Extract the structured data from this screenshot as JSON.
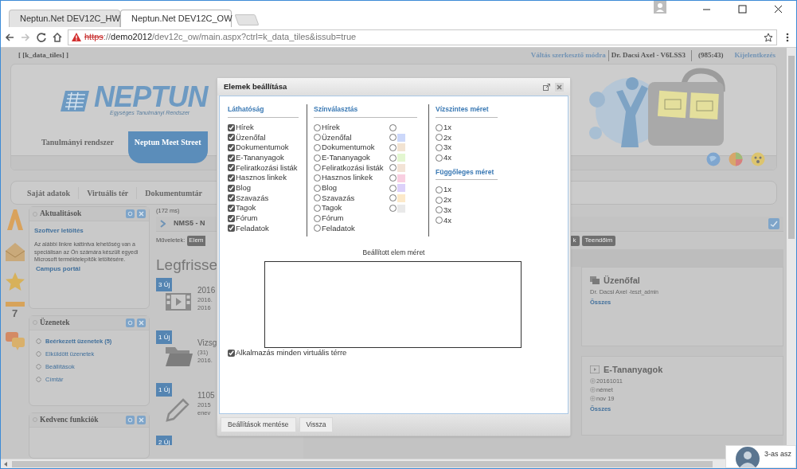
{
  "browser": {
    "tabs": [
      {
        "title": "Neptun.Net DEV12C_HW",
        "selected": false
      },
      {
        "title": "Neptun.Net DEV12C_OW",
        "selected": true
      }
    ],
    "url": {
      "scheme": "https",
      "separator": "://",
      "host": "demo2012",
      "path": "/dev12c_ow/main.aspx?ctrl=k_data_tiles&issub=true"
    }
  },
  "page": {
    "breadcrumb": "[ [k_data_tiles] ]",
    "top_links": {
      "edit_mode": "Váltás szerkesztő módra",
      "user": "Dr. Dacsi Axel - V6LSS3",
      "timer": "(985:43)",
      "logout": "Kijelentkezés"
    },
    "header": {
      "logo": "NEPTUN",
      "logo_subtitle": "Egységes Tanulmányi Rendszer",
      "system_tabs": [
        {
          "label": "Tanulmányi rendszer",
          "selected": false
        },
        {
          "label": "Neptun Meet Street",
          "selected": true
        }
      ]
    },
    "nav": [
      "Saját adatok",
      "Virtuális tér",
      "Dokumentumtár"
    ],
    "calendar_day": "7",
    "widgets": [
      {
        "title": "Aktualitások",
        "heading": "Szoftver letöltés",
        "text": "Az alábbi linkre kattintva lehetőség van a speciálisan az Ön számára készült egyedi Microsoft terméktelepítők letöltésére.",
        "link": "Campus portál"
      },
      {
        "title": "Üzenetek",
        "links": [
          {
            "text": "Beérkezett üzenetek (5)",
            "unread": true
          },
          {
            "text": "Elküldött üzenetek",
            "unread": false
          },
          {
            "text": "Beállítások",
            "unread": false
          },
          {
            "text": "Címtár",
            "unread": false
          }
        ]
      },
      {
        "title": "Kedvenc funkciók"
      }
    ],
    "timing": "(172 ms)",
    "bar_title": "NMS5 - N",
    "actions_label": "Műveletek:",
    "action_buttons": [
      "Elem"
    ],
    "right_buttons": [
      "k",
      "Teendőim"
    ],
    "heading": "Legfrisse",
    "feed": [
      {
        "badge": "3 Új",
        "kind": "video",
        "lines": [
          "2016",
          "2016.",
          "2016"
        ]
      },
      {
        "badge": "1 Új",
        "kind": "folder",
        "lines": [
          "Vizsg",
          "(31)",
          "2016."
        ]
      },
      {
        "badge": "1 Új",
        "kind": "pencil",
        "lines": [
          "1105",
          "2015",
          "enev"
        ]
      },
      {
        "badge": "2 Új"
      }
    ],
    "cards": [
      {
        "kind": "wall",
        "title": "Üzenőfal",
        "author": "Dr. Dacsi Axel",
        "author_note": "-teszt_admin",
        "link": "Összes"
      },
      {
        "kind": "elearning",
        "title": "E-Tananyagok",
        "items": [
          "20161011",
          "német",
          "nov 19"
        ],
        "link": "Összes"
      }
    ],
    "notification": "3-as asz"
  },
  "modal": {
    "title": "Elemek beállítása",
    "visibility": {
      "heading": "Láthatóság",
      "items": [
        {
          "label": "Hírek",
          "checked": true
        },
        {
          "label": "Üzenőfal",
          "checked": true
        },
        {
          "label": "Dokumentumok",
          "checked": true
        },
        {
          "label": "E-Tananyagok",
          "checked": true
        },
        {
          "label": "Feliratkozási listák",
          "checked": true
        },
        {
          "label": "Hasznos linkek",
          "checked": true
        },
        {
          "label": "Blog",
          "checked": true
        },
        {
          "label": "Szavazás",
          "checked": true
        },
        {
          "label": "Tagok",
          "checked": true
        },
        {
          "label": "Fórum",
          "checked": true
        },
        {
          "label": "Feladatok",
          "checked": true
        }
      ]
    },
    "colors": {
      "heading": "Színválasztás",
      "items": [
        {
          "label": "Hírek",
          "selected": false
        },
        {
          "label": "Üzenőfal",
          "selected": false
        },
        {
          "label": "Dokumentumok",
          "selected": false
        },
        {
          "label": "E-Tananyagok",
          "selected": false
        },
        {
          "label": "Feliratkozási listák",
          "selected": false
        },
        {
          "label": "Hasznos linkek",
          "selected": false
        },
        {
          "label": "Blog",
          "selected": false
        },
        {
          "label": "Szavazás",
          "selected": false
        },
        {
          "label": "Tagok",
          "selected": false
        },
        {
          "label": "Fórum",
          "selected": false
        },
        {
          "label": "Feladatok",
          "selected": false
        }
      ],
      "swatches": [
        {
          "selected": false
        },
        {
          "color": "#ccd8fa",
          "selected": false
        },
        {
          "color": "#f2e3d2",
          "selected": false
        },
        {
          "color": "#e3f6d0",
          "selected": false
        },
        {
          "color": "#f3e3d6",
          "selected": false
        },
        {
          "color": "#f9cfe1",
          "selected": false
        },
        {
          "color": "#dcd1fa",
          "selected": false
        },
        {
          "color": "#fce9c9",
          "selected": false
        },
        {
          "color": "#e9e9e9",
          "selected": false
        }
      ]
    },
    "horizontal_size": {
      "heading": "Vízszintes méret",
      "options": [
        {
          "label": "1x",
          "selected": false
        },
        {
          "label": "2x",
          "selected": false
        },
        {
          "label": "3x",
          "selected": false
        },
        {
          "label": "4x",
          "selected": false
        }
      ]
    },
    "vertical_size": {
      "heading": "Függőleges méret",
      "options": [
        {
          "label": "1x",
          "selected": false
        },
        {
          "label": "2x",
          "selected": false
        },
        {
          "label": "3x",
          "selected": false
        },
        {
          "label": "4x",
          "selected": false
        }
      ]
    },
    "preview_label": "Beállított elem méret",
    "apply_all": {
      "label": "Alkalmazás minden virtuális térre",
      "checked": true
    },
    "buttons": [
      "Beállítások mentése",
      "Vissza"
    ]
  }
}
